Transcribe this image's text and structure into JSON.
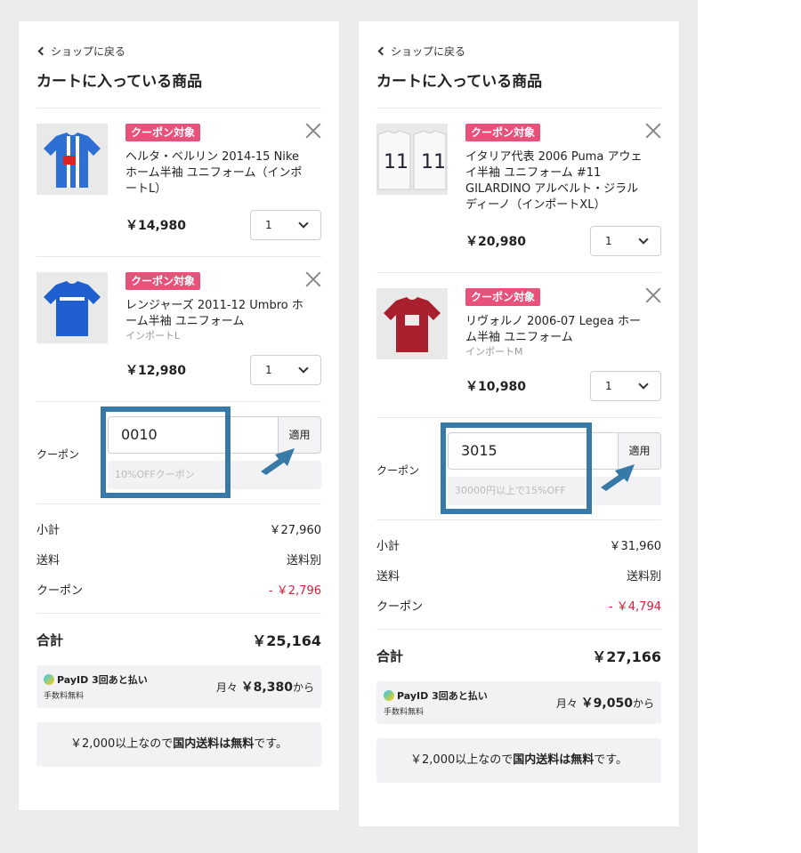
{
  "panels": [
    {
      "back": "ショップに戻る",
      "title": "カートに入っている商品",
      "items": [
        {
          "tag": "クーポン対象",
          "name": "ヘルタ・ベルリン 2014-15 Nike ホーム半袖 ユニフォーム（インポートL）",
          "variant": "",
          "price": "￥14,980",
          "qty": "1",
          "shirt_color": "#2e6fd3"
        },
        {
          "tag": "クーポン対象",
          "name": "レンジャーズ 2011-12 Umbro ホーム半袖 ユニフォーム",
          "variant": "インポートL",
          "price": "￥12,980",
          "qty": "1",
          "shirt_color": "#1f5fd0"
        }
      ],
      "coupon": {
        "label": "クーポン",
        "code": "0010",
        "apply": "適用",
        "info": "10%OFFクーポン"
      },
      "subtotal_label": "小計",
      "subtotal": "￥27,960",
      "shipping_label": "送料",
      "shipping": "送料別",
      "coupon_label": "クーポン",
      "coupon_discount": "- ￥2,796",
      "total_label": "合計",
      "total": "￥25,164",
      "payid": {
        "name": "PayID 3回あと払い",
        "fee": "手数料無料",
        "prefix": "月々",
        "amount": "￥8,380",
        "suffix": "から"
      },
      "note_a": "￥2,000以上なので",
      "note_b": "国内送料は無料",
      "note_c": "です。"
    },
    {
      "back": "ショップに戻る",
      "title": "カートに入っている商品",
      "items": [
        {
          "tag": "クーポン対象",
          "name": "イタリア代表 2006 Puma アウェイ半袖 ユニフォーム #11 GILARDINO アルベルト・ジラルディーノ（インポートXL）",
          "variant": "",
          "price": "￥20,980",
          "qty": "1",
          "shirt_color": "#f4f4f4"
        },
        {
          "tag": "クーポン対象",
          "name": "リヴォルノ 2006-07 Legea ホーム半袖 ユニフォーム",
          "variant": "インポートM",
          "price": "￥10,980",
          "qty": "1",
          "shirt_color": "#a8202e"
        }
      ],
      "coupon": {
        "label": "クーポン",
        "code": "3015",
        "apply": "適用",
        "info": "30000円以上で15%OFF"
      },
      "subtotal_label": "小計",
      "subtotal": "￥31,960",
      "shipping_label": "送料",
      "shipping": "送料別",
      "coupon_label": "クーポン",
      "coupon_discount": "- ￥4,794",
      "total_label": "合計",
      "total": "￥27,166",
      "payid": {
        "name": "PayID 3回あと払い",
        "fee": "手数料無料",
        "prefix": "月々",
        "amount": "￥9,050",
        "suffix": "から"
      },
      "note_a": "￥2,000以上なので",
      "note_b": "国内送料は無料",
      "note_c": "です。"
    }
  ],
  "colors": {
    "accent_tag": "#e9507a",
    "highlight": "#3779a7",
    "discount": "#d8193a"
  }
}
